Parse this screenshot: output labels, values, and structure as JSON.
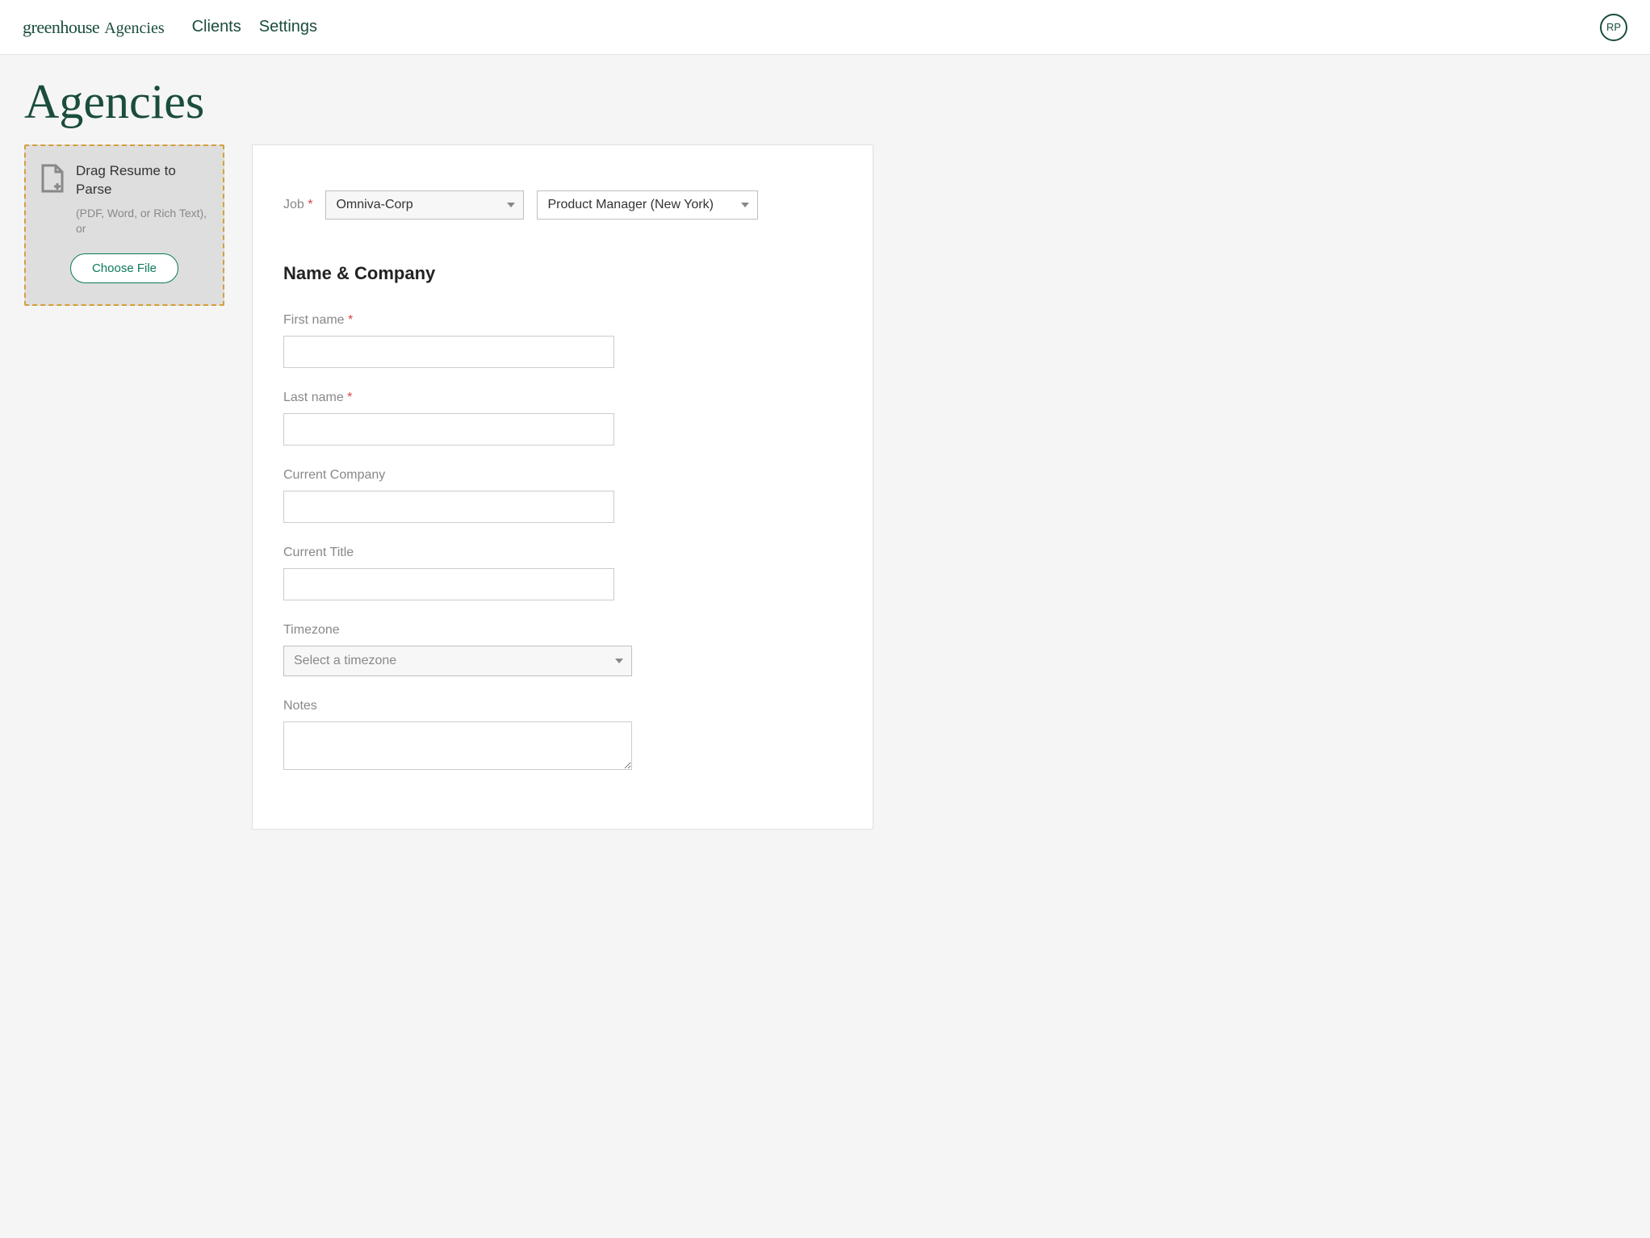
{
  "header": {
    "logo": "greenhouse",
    "logo_sub": "Agencies",
    "nav": {
      "clients": "Clients",
      "settings": "Settings"
    },
    "avatar_initials": "RP"
  },
  "page_title": "Agencies",
  "drop_zone": {
    "title": "Drag Resume to Parse",
    "subtitle": "(PDF, Word, or Rich Text), or",
    "button": "Choose File"
  },
  "form": {
    "job_label": "Job",
    "company_select": "Omniva-Corp",
    "position_select": "Product Manager (New York)",
    "section_heading": "Name & Company",
    "fields": {
      "first_name": {
        "label": "First name",
        "value": "",
        "required": true
      },
      "last_name": {
        "label": "Last name",
        "value": "",
        "required": true
      },
      "current_company": {
        "label": "Current Company",
        "value": ""
      },
      "current_title": {
        "label": "Current Title",
        "value": ""
      },
      "timezone": {
        "label": "Timezone",
        "placeholder": "Select a timezone"
      },
      "notes": {
        "label": "Notes",
        "value": ""
      }
    }
  }
}
